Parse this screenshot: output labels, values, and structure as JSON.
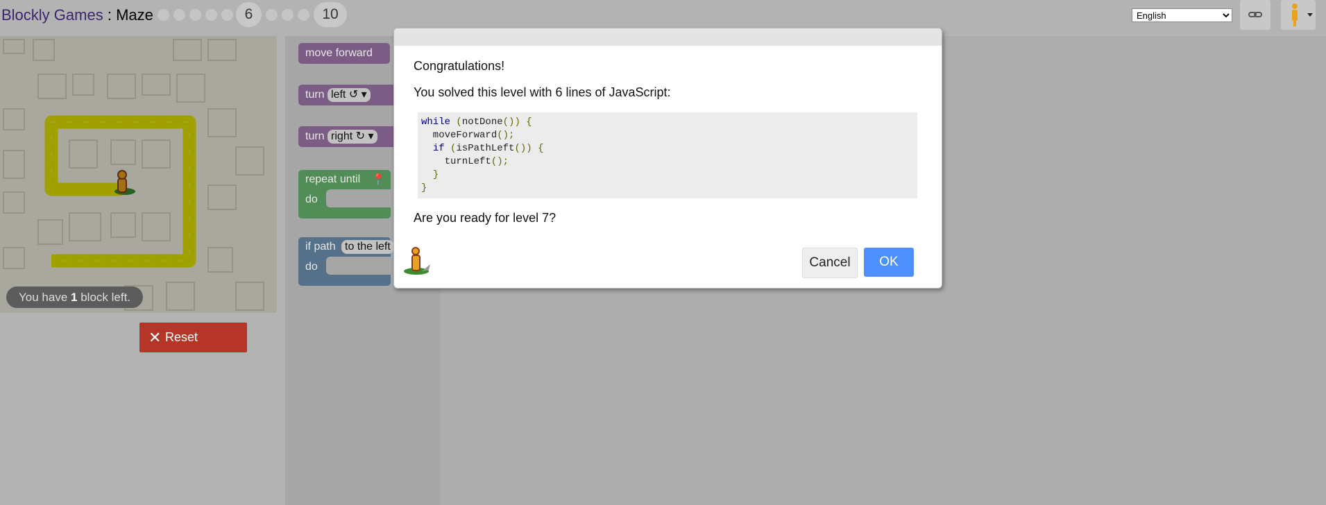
{
  "header": {
    "app_name": "Blockly Games",
    "separator": ":",
    "game_name": "Maze",
    "current_level": "6",
    "last_level": "10",
    "language": "English"
  },
  "maze": {
    "capacity_prefix": "You have",
    "capacity_count": "1",
    "capacity_suffix": "block left.",
    "reset_label": "Reset"
  },
  "toolbox": {
    "move_forward": "move forward",
    "turn_label": "turn",
    "left_option": "left ↺",
    "right_option": "right ↻",
    "repeat_until": "repeat until",
    "do_label": "do",
    "if_path": "if path",
    "to_the_left": "to the left"
  },
  "dialog": {
    "heading": "Congratulations!",
    "solved_text": "You solved this level with 6 lines of JavaScript:",
    "code_lines": [
      "while (notDone()) {",
      "  moveForward();",
      "  if (isPathLeft()) {",
      "    turnLeft();",
      "  }",
      "}"
    ],
    "question": "Are you ready for level 7?",
    "cancel_label": "Cancel",
    "ok_label": "OK"
  },
  "colors": {
    "path": "#e6e600",
    "ok_button": "#4d90fe",
    "reset_button": "#b53629",
    "move_block": "#925aa4",
    "loop_block": "#56a25b",
    "logic_block": "#5b80a5"
  },
  "icons": [
    "link-icon",
    "pegman-icon",
    "marker-icon",
    "close-icon"
  ]
}
